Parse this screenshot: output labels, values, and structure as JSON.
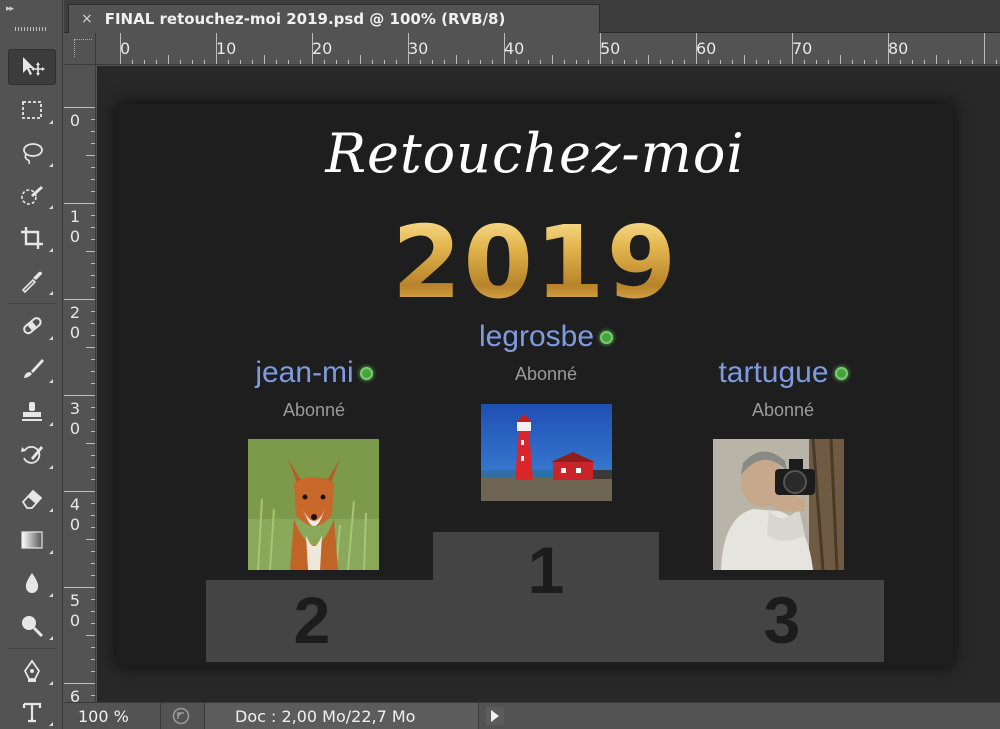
{
  "document": {
    "tab_title": "FINAL retouchez-moi 2019.psd @ 100% (RVB/8)",
    "close_glyph": "×"
  },
  "rulers": {
    "horizontal": [
      "0",
      "10",
      "20",
      "30",
      "40",
      "50",
      "60",
      "70",
      "80"
    ],
    "vertical": [
      [
        "0"
      ],
      [
        "1",
        "0"
      ],
      [
        "2",
        "0"
      ],
      [
        "3",
        "0"
      ],
      [
        "4",
        "0"
      ],
      [
        "5",
        "0"
      ],
      [
        "6"
      ]
    ]
  },
  "tools": [
    {
      "name": "move-tool",
      "icon": "move-icon",
      "active": true
    },
    {
      "name": "marquee-tool",
      "icon": "rectangular-marquee-icon"
    },
    {
      "name": "lasso-tool",
      "icon": "lasso-icon"
    },
    {
      "name": "quick-selection-tool",
      "icon": "quick-selection-icon"
    },
    {
      "name": "crop-tool",
      "icon": "crop-icon"
    },
    {
      "name": "eyedropper-tool",
      "icon": "eyedropper-icon"
    },
    {
      "name": "healing-brush-tool",
      "icon": "bandage-icon"
    },
    {
      "name": "brush-tool",
      "icon": "brush-icon"
    },
    {
      "name": "clone-stamp-tool",
      "icon": "stamp-icon"
    },
    {
      "name": "history-brush-tool",
      "icon": "history-brush-icon"
    },
    {
      "name": "eraser-tool",
      "icon": "eraser-icon"
    },
    {
      "name": "gradient-tool",
      "icon": "gradient-icon"
    },
    {
      "name": "blur-tool",
      "icon": "drop-icon"
    },
    {
      "name": "dodge-tool",
      "icon": "dodge-icon"
    },
    {
      "name": "pen-tool",
      "icon": "pen-icon"
    },
    {
      "name": "type-tool",
      "icon": "type-icon"
    }
  ],
  "artwork": {
    "title": "Retouchez-moi",
    "year": "2019",
    "users": [
      {
        "rank": "1",
        "name": "legrosbe",
        "status": "Abonné",
        "avatar": "lighthouse-photo"
      },
      {
        "rank": "2",
        "name": "jean-mi",
        "status": "Abonné",
        "avatar": "fox-photo"
      },
      {
        "rank": "3",
        "name": "tartugue",
        "status": "Abonné",
        "avatar": "photographer-photo"
      }
    ]
  },
  "statusbar": {
    "zoom": "100 %",
    "doc_info": "Doc : 2,00 Mo/22,7 Mo"
  },
  "colors": {
    "ui_panel": "#535353",
    "canvas_bg": "#1e1e1e",
    "podium": "#444444",
    "username": "#7f9be0",
    "online": "#43a53a",
    "gold": "#d8a93a"
  }
}
